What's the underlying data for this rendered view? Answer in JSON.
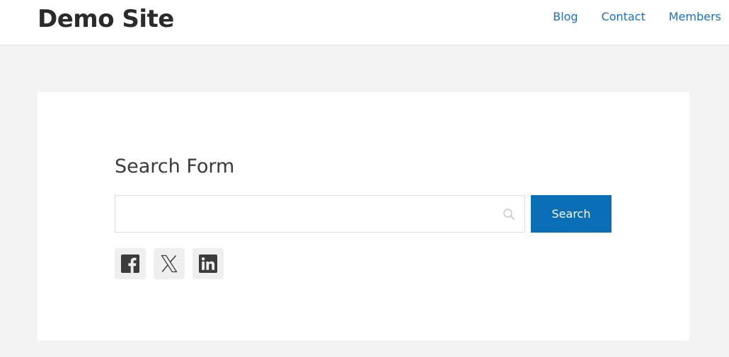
{
  "site": {
    "title": "Demo Site"
  },
  "nav": {
    "items": [
      {
        "label": "Blog"
      },
      {
        "label": "Contact"
      },
      {
        "label": "Members"
      }
    ]
  },
  "search_form": {
    "heading": "Search Form",
    "input_value": "",
    "input_placeholder": "",
    "input_icon": "search-icon",
    "button_label": "Search"
  },
  "social": {
    "items": [
      {
        "icon": "facebook-icon"
      },
      {
        "icon": "x-twitter-icon"
      },
      {
        "icon": "linkedin-icon"
      }
    ]
  },
  "colors": {
    "accent": "#0b6fb8",
    "link": "#1f6fbf",
    "page_background": "#f3f3f3",
    "card_background": "#ffffff",
    "icon_dark": "#3c3c3c"
  }
}
